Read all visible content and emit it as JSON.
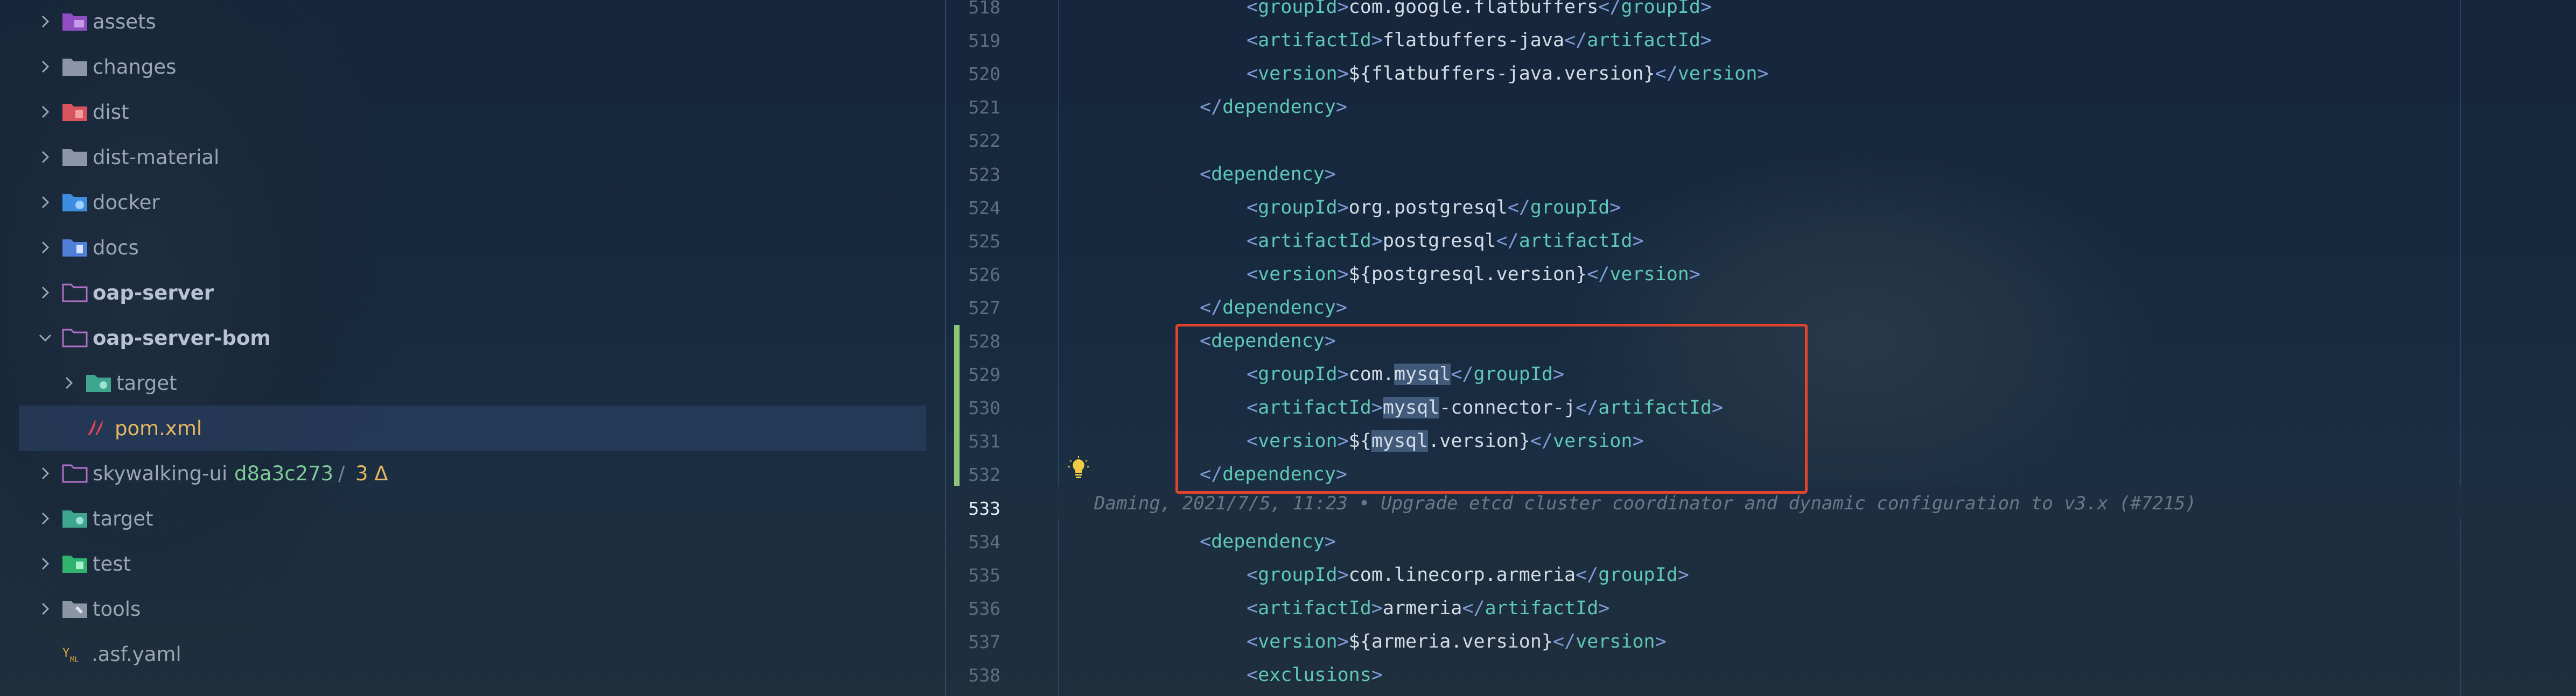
{
  "sidebar": {
    "items": [
      {
        "label": "assets",
        "icon": "assets-folder-icon",
        "expanded": false
      },
      {
        "label": "changes",
        "icon": "folder-icon",
        "expanded": false
      },
      {
        "label": "dist",
        "icon": "dist-folder-icon",
        "expanded": false
      },
      {
        "label": "dist-material",
        "icon": "folder-icon",
        "expanded": false
      },
      {
        "label": "docker",
        "icon": "docker-folder-icon",
        "expanded": false
      },
      {
        "label": "docs",
        "icon": "docs-folder-icon",
        "expanded": false
      },
      {
        "label": "oap-server",
        "icon": "folder-outline-icon",
        "expanded": false
      },
      {
        "label": "oap-server-bom",
        "icon": "folder-outline-icon",
        "expanded": true
      },
      {
        "label": "target",
        "icon": "target-folder-icon",
        "expanded": false
      },
      {
        "label": "pom.xml",
        "icon": "maven-icon",
        "selected": true
      },
      {
        "label": "skywalking-ui",
        "icon": "folder-outline-icon",
        "expanded": false,
        "git_hash": "d8a3c273",
        "git_sep": "/",
        "git_changes": "3 Δ"
      },
      {
        "label": "target",
        "icon": "target-folder-icon",
        "expanded": false
      },
      {
        "label": "test",
        "icon": "test-folder-icon",
        "expanded": false
      },
      {
        "label": "tools",
        "icon": "tools-folder-icon",
        "expanded": false
      },
      {
        "label": ".asf.yaml",
        "icon": "yaml-file-icon"
      }
    ]
  },
  "editor": {
    "current_line": "533",
    "blame": "Daming, 2021/7/5, 11:23 • Upgrade etcd cluster coordinator and dynamic configuration to v3.x (#7215)",
    "lines": [
      {
        "n": "518",
        "indent": 2,
        "tag": "groupId",
        "value": "com.google.flatbuffers"
      },
      {
        "n": "519",
        "indent": 2,
        "tag": "artifactId",
        "value": "flatbuffers-java"
      },
      {
        "n": "520",
        "indent": 2,
        "tag": "version",
        "value": "${flatbuffers-java.version}"
      },
      {
        "n": "521",
        "indent": 1,
        "close": "dependency"
      },
      {
        "n": "522",
        "indent": 0,
        "blank": true
      },
      {
        "n": "523",
        "indent": 1,
        "open": "dependency"
      },
      {
        "n": "524",
        "indent": 2,
        "tag": "groupId",
        "value": "org.postgresql"
      },
      {
        "n": "525",
        "indent": 2,
        "tag": "artifactId",
        "value": "postgresql"
      },
      {
        "n": "526",
        "indent": 2,
        "tag": "version",
        "value": "${postgresql.version}"
      },
      {
        "n": "527",
        "indent": 1,
        "close": "dependency"
      },
      {
        "n": "528",
        "indent": 1,
        "open": "dependency"
      },
      {
        "n": "529",
        "indent": 2,
        "tag": "groupId",
        "pre": "com.",
        "hl": "mysql",
        "post": ""
      },
      {
        "n": "530",
        "indent": 2,
        "tag": "artifactId",
        "pre": "",
        "hl": "mysql",
        "post": "-connector-j"
      },
      {
        "n": "531",
        "indent": 2,
        "tag": "version",
        "pre": "${",
        "hl": "mysql",
        "post": ".version}"
      },
      {
        "n": "532",
        "indent": 1,
        "close": "dependency"
      },
      {
        "n": "533",
        "indent": 0,
        "blank": true
      },
      {
        "n": "534",
        "indent": 1,
        "open": "dependency"
      },
      {
        "n": "535",
        "indent": 2,
        "tag": "groupId",
        "value": "com.linecorp.armeria"
      },
      {
        "n": "536",
        "indent": 2,
        "tag": "artifactId",
        "value": "armeria"
      },
      {
        "n": "537",
        "indent": 2,
        "tag": "version",
        "value": "${armeria.version}"
      },
      {
        "n": "538",
        "indent": 2,
        "open": "exclusions"
      }
    ]
  },
  "colors": {
    "tag": "#5fc7b7",
    "bracket": "#7d9bd6",
    "text": "#d3dbe6",
    "selection_border": "#e0442c",
    "git_added_gutter": "#8fc476",
    "git_hash": "#7fc99b",
    "modified": "#e8b860"
  }
}
